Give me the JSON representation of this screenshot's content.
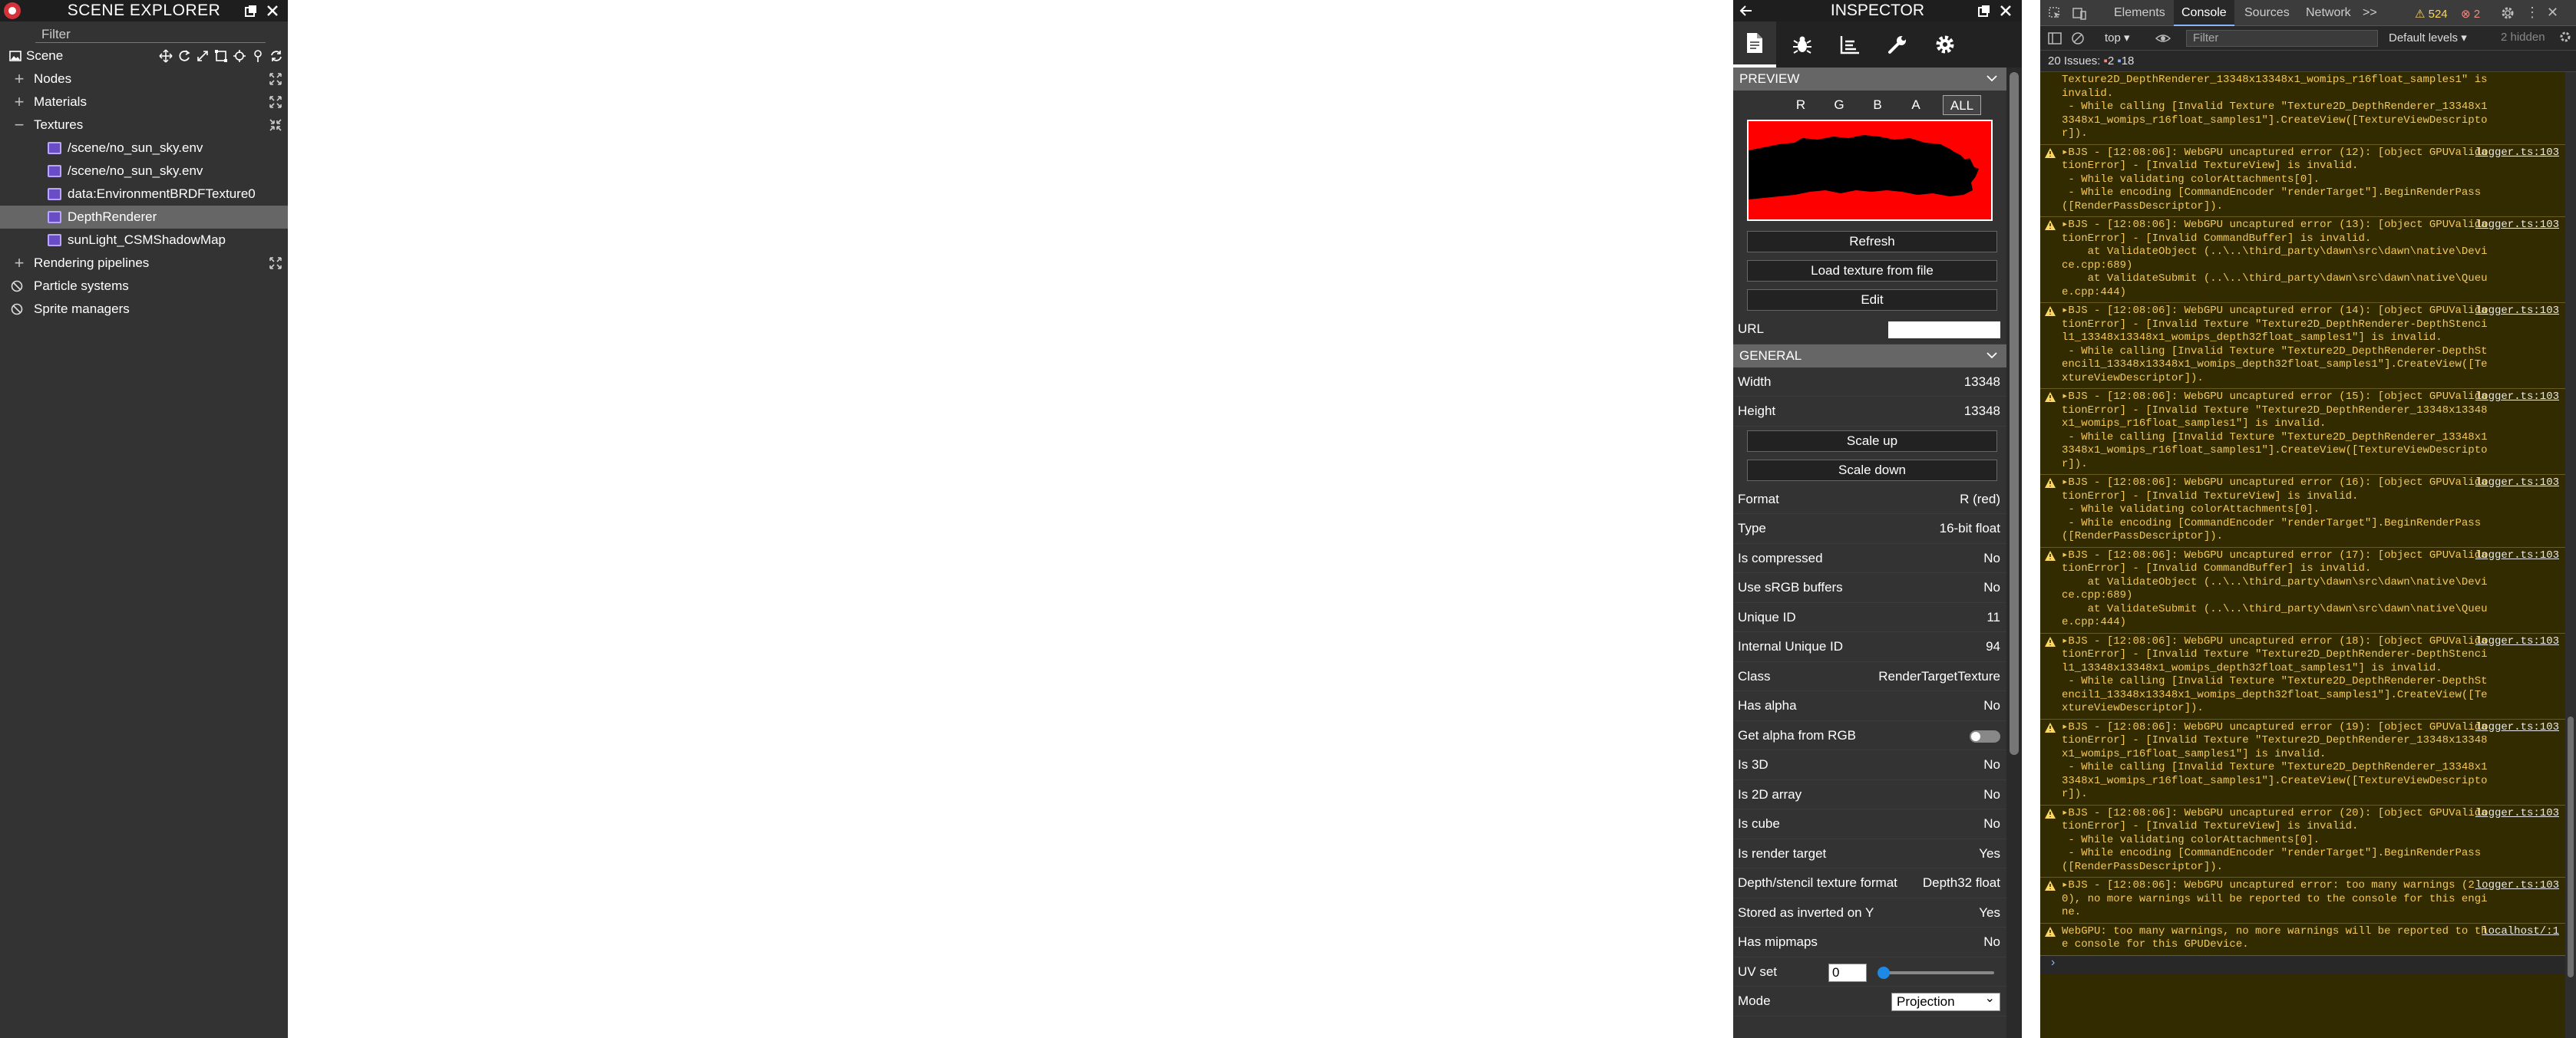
{
  "scene_explorer": {
    "title": "SCENE EXPLORER",
    "filter_placeholder": "Filter",
    "scene_label": "Scene",
    "nodes_label": "Nodes",
    "materials_label": "Materials",
    "textures_label": "Textures",
    "textures": [
      "/scene/no_sun_sky.env",
      "/scene/no_sun_sky.env",
      "data:EnvironmentBRDFTexture0",
      "DepthRenderer",
      "sunLight_CSMShadowMap"
    ],
    "selected_texture": "DepthRenderer",
    "rendering_pipelines_label": "Rendering pipelines",
    "particle_systems_label": "Particle systems",
    "sprite_managers_label": "Sprite managers"
  },
  "inspector": {
    "title": "INSPECTOR",
    "preview_header": "PREVIEW",
    "channels": [
      "R",
      "G",
      "B",
      "A",
      "ALL"
    ],
    "active_channel": "ALL",
    "refresh_label": "Refresh",
    "load_label": "Load texture from file",
    "edit_label": "Edit",
    "url_label": "URL",
    "general_header": "GENERAL",
    "width_label": "Width",
    "width_value": "13348",
    "height_label": "Height",
    "height_value": "13348",
    "scale_up_label": "Scale up",
    "scale_down_label": "Scale down",
    "properties": [
      {
        "k": "Format",
        "v": "R (red)"
      },
      {
        "k": "Type",
        "v": "16-bit float"
      },
      {
        "k": "Is compressed",
        "v": "No"
      },
      {
        "k": "Use sRGB buffers",
        "v": "No"
      },
      {
        "k": "Unique ID",
        "v": "11"
      },
      {
        "k": "Internal Unique ID",
        "v": "94"
      },
      {
        "k": "Class",
        "v": "RenderTargetTexture"
      },
      {
        "k": "Has alpha",
        "v": "No"
      },
      {
        "k": "Get alpha from RGB",
        "v": ""
      },
      {
        "k": "Is 3D",
        "v": "No"
      },
      {
        "k": "Is 2D array",
        "v": "No"
      },
      {
        "k": "Is cube",
        "v": "No"
      },
      {
        "k": "Is render target",
        "v": "Yes"
      },
      {
        "k": "Depth/stencil texture format",
        "v": "Depth32 float"
      },
      {
        "k": "Stored as inverted on Y",
        "v": "Yes"
      },
      {
        "k": "Has mipmaps",
        "v": "No"
      }
    ],
    "uv_set_label": "UV set",
    "uv_set_value": "0",
    "mode_label": "Mode",
    "mode_value": "Projection"
  },
  "devtools": {
    "tabs": [
      "Elements",
      "Console",
      "Sources",
      "Network",
      ">>"
    ],
    "active_tab": "Console",
    "warnings_count": "524",
    "errors_count": "2",
    "context": "top",
    "filter_placeholder": "Filter",
    "levels": "Default levels",
    "hidden": "2 hidden",
    "issues_text": "20 Issues:",
    "issues_errors": "2",
    "issues_info": "18",
    "partial_first": "Texture2D_DepthRenderer_13348x13348x1_womips_r16float_samples1\" is invalid.\n - While calling [Invalid Texture \"Texture2D_DepthRenderer_13348x13348x1_womips_r16float_samples1\"].CreateView([TextureViewDescriptor]).",
    "messages": [
      {
        "text": "▸BJS - [12:08:06]: WebGPU uncaptured error (12): [object GPUValidationError] - [Invalid TextureView] is invalid.\n - While validating colorAttachments[0].\n - While encoding [CommandEncoder \"renderTarget\"].BeginRenderPass([RenderPassDescriptor]).",
        "src": "logger.ts:103"
      },
      {
        "text": "▸BJS - [12:08:06]: WebGPU uncaptured error (13): [object GPUValidationError] - [Invalid CommandBuffer] is invalid.\n    at ValidateObject (..\\..\\third_party\\dawn\\src\\dawn\\native\\Device.cpp:689)\n    at ValidateSubmit (..\\..\\third_party\\dawn\\src\\dawn\\native\\Queue.cpp:444)",
        "src": "logger.ts:103"
      },
      {
        "text": "▸BJS - [12:08:06]: WebGPU uncaptured error (14): [object GPUValidationError] - [Invalid Texture \"Texture2D_DepthRenderer-DepthStencil1_13348x13348x1_womips_depth32float_samples1\"] is invalid.\n - While calling [Invalid Texture \"Texture2D_DepthRenderer-DepthStencil1_13348x13348x1_womips_depth32float_samples1\"].CreateView([TextureViewDescriptor]).",
        "src": "logger.ts:103"
      },
      {
        "text": "▸BJS - [12:08:06]: WebGPU uncaptured error (15): [object GPUValidationError] - [Invalid Texture \"Texture2D_DepthRenderer_13348x13348x1_womips_r16float_samples1\"] is invalid.\n - While calling [Invalid Texture \"Texture2D_DepthRenderer_13348x13348x1_womips_r16float_samples1\"].CreateView([TextureViewDescriptor]).",
        "src": "logger.ts:103"
      },
      {
        "text": "▸BJS - [12:08:06]: WebGPU uncaptured error (16): [object GPUValidationError] - [Invalid TextureView] is invalid.\n - While validating colorAttachments[0].\n - While encoding [CommandEncoder \"renderTarget\"].BeginRenderPass([RenderPassDescriptor]).",
        "src": "logger.ts:103"
      },
      {
        "text": "▸BJS - [12:08:06]: WebGPU uncaptured error (17): [object GPUValidationError] - [Invalid CommandBuffer] is invalid.\n    at ValidateObject (..\\..\\third_party\\dawn\\src\\dawn\\native\\Device.cpp:689)\n    at ValidateSubmit (..\\..\\third_party\\dawn\\src\\dawn\\native\\Queue.cpp:444)",
        "src": "logger.ts:103"
      },
      {
        "text": "▸BJS - [12:08:06]: WebGPU uncaptured error (18): [object GPUValidationError] - [Invalid Texture \"Texture2D_DepthRenderer-DepthStencil1_13348x13348x1_womips_depth32float_samples1\"] is invalid.\n - While calling [Invalid Texture \"Texture2D_DepthRenderer-DepthStencil1_13348x13348x1_womips_depth32float_samples1\"].CreateView([TextureViewDescriptor]).",
        "src": "logger.ts:103"
      },
      {
        "text": "▸BJS - [12:08:06]: WebGPU uncaptured error (19): [object GPUValidationError] - [Invalid Texture \"Texture2D_DepthRenderer_13348x13348x1_womips_r16float_samples1\"] is invalid.\n - While calling [Invalid Texture \"Texture2D_DepthRenderer_13348x13348x1_womips_r16float_samples1\"].CreateView([TextureViewDescriptor]).",
        "src": "logger.ts:103"
      },
      {
        "text": "▸BJS - [12:08:06]: WebGPU uncaptured error (20): [object GPUValidationError] - [Invalid TextureView] is invalid.\n - While validating colorAttachments[0].\n - While encoding [CommandEncoder \"renderTarget\"].BeginRenderPass([RenderPassDescriptor]).",
        "src": "logger.ts:103"
      },
      {
        "text": "▸BJS - [12:08:06]: WebGPU uncaptured error: too many warnings (20), no more warnings will be reported to the console for this engine.",
        "src": "logger.ts:103"
      },
      {
        "text": "WebGPU: too many warnings, no more warnings will be reported to the console for this GPUDevice.",
        "src": "localhost/:1"
      }
    ]
  },
  "colors": {
    "panel_bg": "#333333",
    "title_bg": "#1e1e1e",
    "preview_red": "#ff0000",
    "selected_row": "#666666",
    "warning_bg": "#332b00",
    "warning_text": "#f2c85b"
  }
}
